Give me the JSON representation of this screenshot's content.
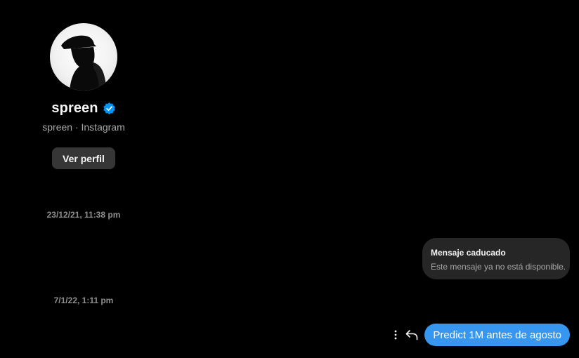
{
  "profile": {
    "name": "spreen",
    "subtitle": "spreen · Instagram",
    "view_profile_label": "Ver perfil"
  },
  "timestamps": [
    "23/12/21, 11:38 pm",
    "7/1/22, 1:11 pm"
  ],
  "expired_message": {
    "title": "Mensaje caducado",
    "body": "Este mensaje ya no está disponible."
  },
  "last_message": {
    "text": "Predict 1M antes de agosto"
  },
  "colors": {
    "background": "#000000",
    "bubble_blue": "#3797f0",
    "expired_bubble": "#262626",
    "button_bg": "#363636",
    "verified": "#0095f6"
  },
  "icons": {
    "verified": "verified-badge-icon",
    "more": "more-options-icon",
    "reply": "reply-icon"
  }
}
